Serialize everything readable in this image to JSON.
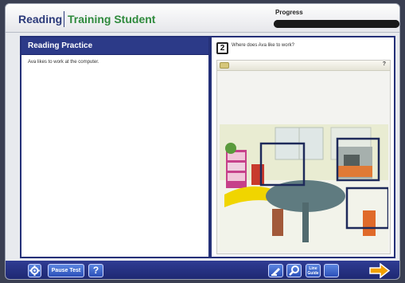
{
  "header": {
    "subject": "Reading",
    "student_name": "Training Student",
    "progress_label": "Progress",
    "progress_value": 1.0
  },
  "passage": {
    "title": "Reading Practice",
    "text": "Ava likes to work at the computer."
  },
  "question": {
    "number": "2",
    "text": "Where does Ava like to work?",
    "answer_help": "?"
  },
  "toolbar": {
    "pause_label": "Pause Test",
    "help_label": "?",
    "line_guide_label_1": "Line",
    "line_guide_label_2": "Guide"
  },
  "colors": {
    "brand_blue": "#2b3a7a",
    "student_green": "#2f8a3d",
    "toolbar_blue": "#2c3a88",
    "next_arrow": "#f0a000",
    "selection_box": "#1e2a5a"
  },
  "icons": [
    "gear-icon",
    "help-icon",
    "highlighter-icon",
    "magnifier-icon",
    "line-guide-icon",
    "next-arrow-icon",
    "pencil-icon"
  ]
}
